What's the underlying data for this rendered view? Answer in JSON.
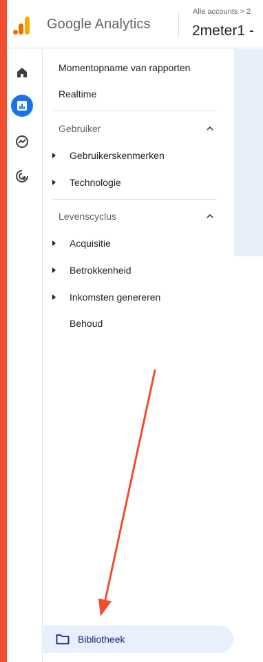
{
  "header": {
    "product_name": "Google Analytics",
    "breadcrumb": "Alle accounts > 2",
    "account_name": "2meter1 -"
  },
  "rail": {
    "items": [
      {
        "icon": "home-icon"
      },
      {
        "icon": "reports-icon",
        "active": true
      },
      {
        "icon": "explore-icon"
      },
      {
        "icon": "advertising-icon"
      }
    ]
  },
  "nav": {
    "snapshot_label": "Momentopname van rapporten",
    "realtime_label": "Realtime",
    "section_user": {
      "label": "Gebruiker",
      "items": [
        "Gebruikerskenmerken",
        "Technologie"
      ]
    },
    "section_lifecycle": {
      "label": "Levenscyclus",
      "items": [
        "Acquisitie",
        "Betrokkenheid",
        "Inkomsten genereren"
      ],
      "retention_label": "Behoud"
    },
    "library_label": "Bibliotheek"
  },
  "colors": {
    "accent": "#1a73e8",
    "border": "#f04e2f",
    "annotation_arrow": "#f04e2f",
    "library_bg": "#e8f0fe"
  }
}
